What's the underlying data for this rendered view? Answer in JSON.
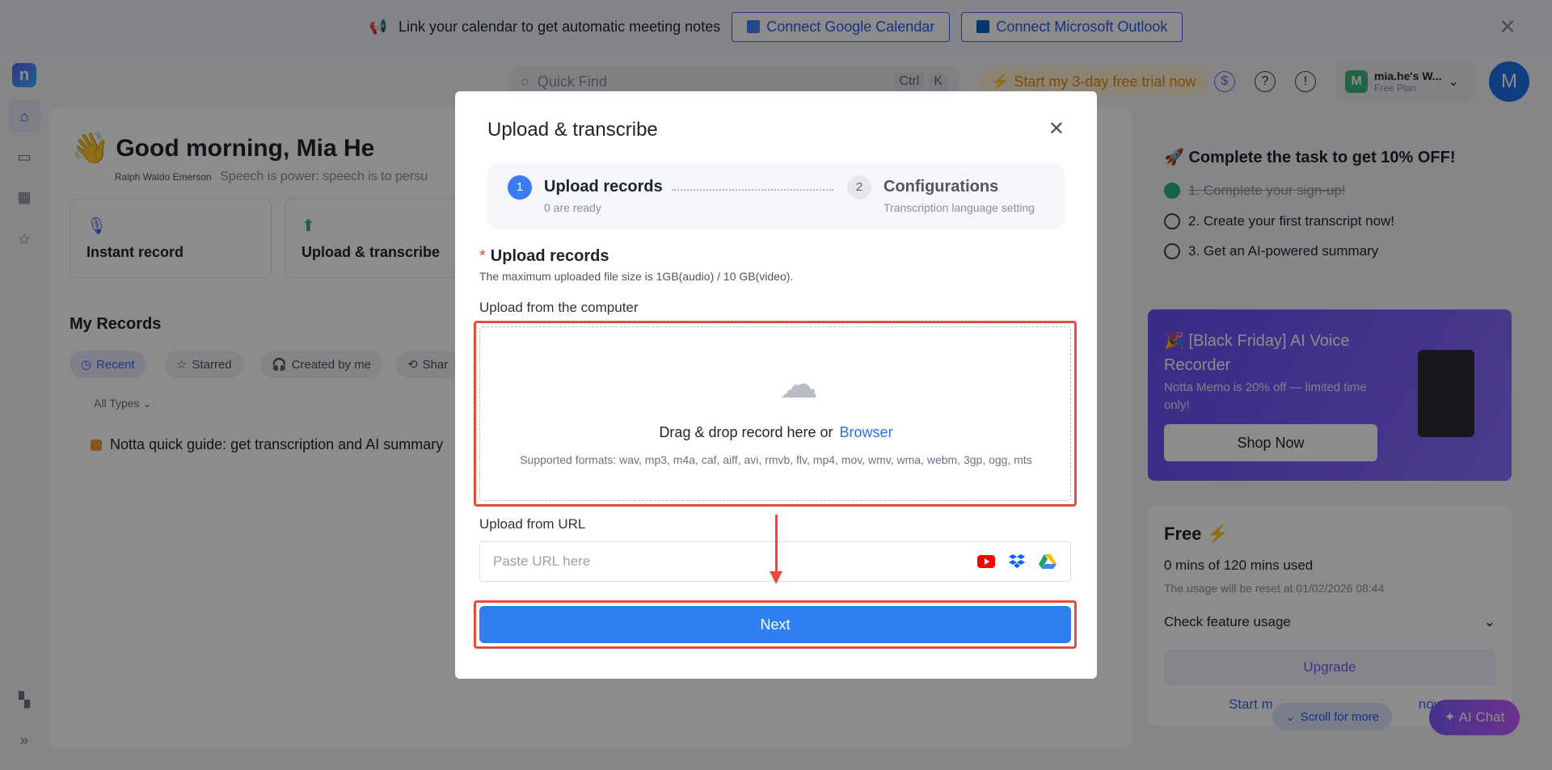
{
  "banner": {
    "message": "Link your calendar to get automatic meeting notes",
    "google_btn": "Connect Google Calendar",
    "outlook_btn": "Connect Microsoft Outlook"
  },
  "header": {
    "search_placeholder": "Quick Find",
    "kbd_ctrl": "Ctrl",
    "kbd_k": "K",
    "trial": "Start my 3-day free trial now",
    "workspace_name": "mia.he's W...",
    "workspace_plan": "Free Plan",
    "workspace_initial": "M",
    "avatar_initial": "M"
  },
  "main": {
    "greeting": "Good morning, Mia He",
    "quote_author": "Ralph Waldo Emerson",
    "quote_text": "Speech is power: speech is to persu",
    "cards": [
      "Instant record",
      "Upload & transcribe"
    ],
    "my_records": "My Records",
    "chips": [
      "Recent",
      "Starred",
      "Created by me",
      "Shar"
    ],
    "types": "All Types",
    "record_item": "Notta quick guide: get transcription and AI summary"
  },
  "right": {
    "task_title": "Complete the task to get 10% OFF!",
    "tasks": [
      "1. Complete your sign-up!",
      "2. Create your first transcript now!",
      "3. Get an AI-powered summary"
    ],
    "promo_title": "[Black Friday] AI Voice Recorder",
    "promo_sub": "Notta Memo is 20% off — limited time only!",
    "promo_btn": "Shop Now",
    "free_title": "Free",
    "free_usage": "0 mins of 120 mins used",
    "free_reset": "The usage will be reset at 01/02/2026 08:44",
    "free_check": "Check feature usage",
    "free_upgrade": "Upgrade",
    "free_start": "Start m",
    "free_start_tail": "now →",
    "scroll_more": "Scroll for more",
    "ai_chat": "AI Chat"
  },
  "modal": {
    "title": "Upload & transcribe",
    "step1_num": "1",
    "step1_label": "Upload records",
    "step1_sub": "0 are ready",
    "step2_num": "2",
    "step2_label": "Configurations",
    "step2_sub": "Transcription language setting",
    "section_required": "*",
    "section_title": "Upload records",
    "section_desc": "The maximum uploaded file size is 1GB(audio) / 10 GB(video).",
    "computer_label": "Upload from the computer",
    "drop_text": "Drag & drop record here or",
    "browse": "Browser",
    "formats": "Supported formats: wav, mp3, m4a, caf, aiff, avi, rmvb, flv, mp4, mov, wmv, wma, webm, 3gp, ogg, mts",
    "url_label": "Upload from URL",
    "url_placeholder": "Paste URL here",
    "next": "Next"
  },
  "colors": {
    "accent": "#2e80f0",
    "highlight": "#e84a3c",
    "trial": "#e08a00"
  }
}
